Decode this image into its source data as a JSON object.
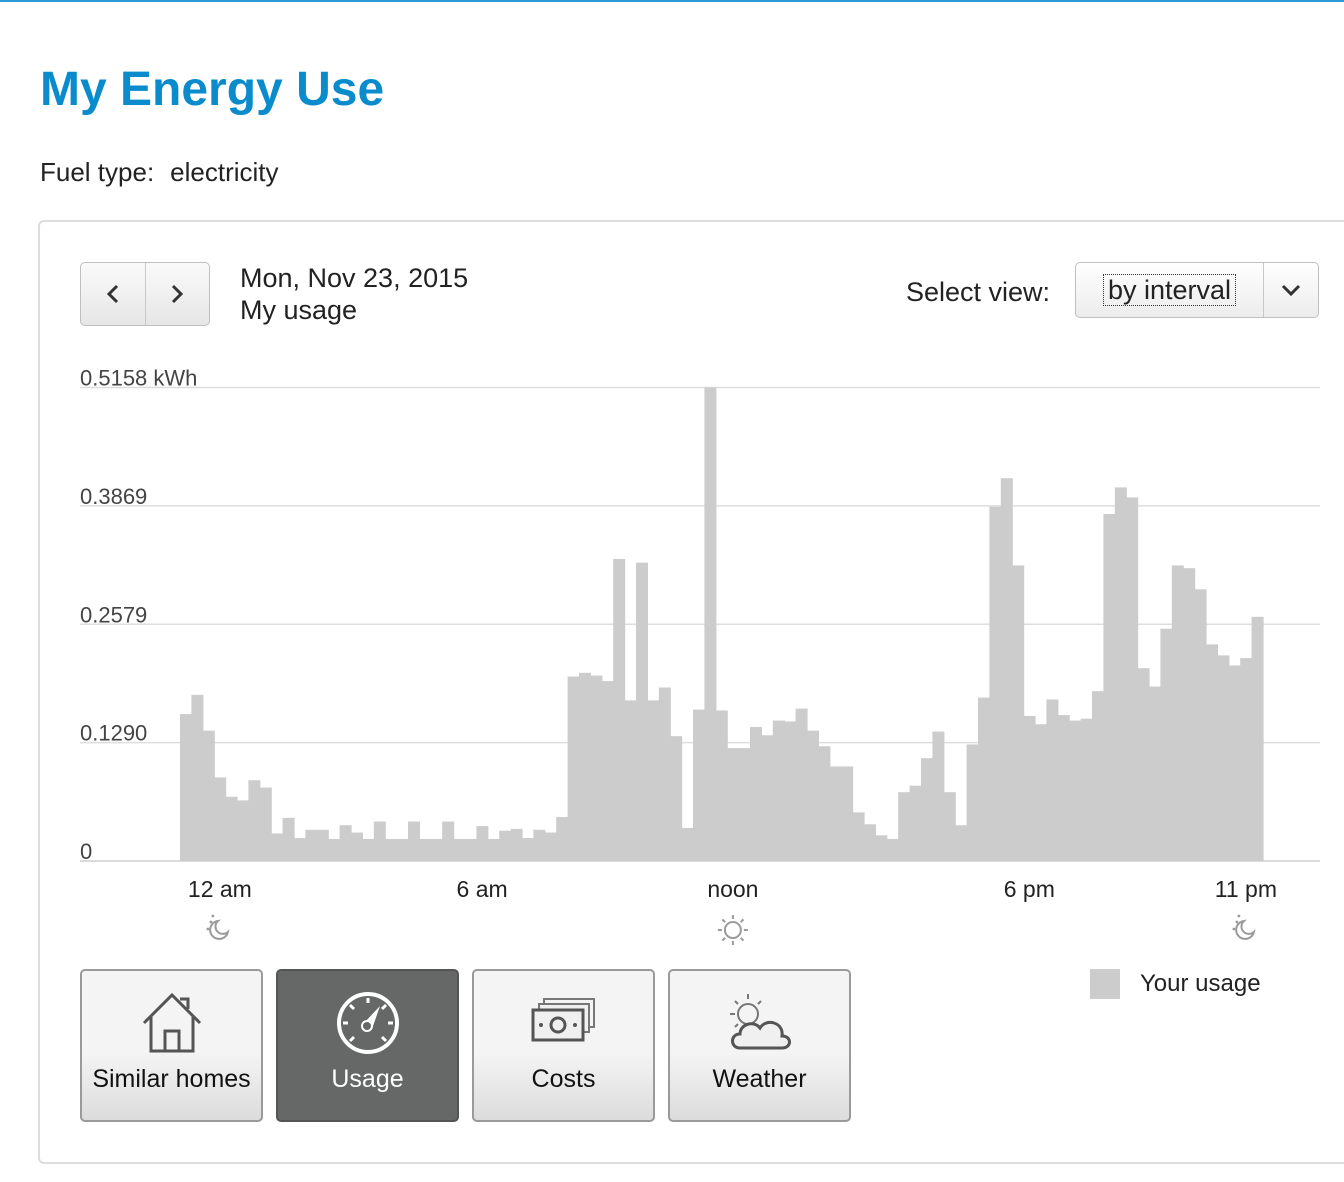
{
  "header": {
    "title": "My Energy Use",
    "fuel_label": "Fuel type:",
    "fuel_value": "electricity"
  },
  "controls": {
    "date": "Mon, Nov 23, 2015",
    "subtitle": "My usage",
    "view_label": "Select view:",
    "view_value": "by interval",
    "prev_icon": "chevron-left-icon",
    "next_icon": "chevron-right-icon"
  },
  "chart_data": {
    "type": "bar",
    "ylabel": "",
    "y_ticks": [
      {
        "value": 0.5158,
        "label": "0.5158 kWh"
      },
      {
        "value": 0.3869,
        "label": "0.3869"
      },
      {
        "value": 0.2579,
        "label": "0.2579"
      },
      {
        "value": 0.129,
        "label": "0.1290"
      },
      {
        "value": 0,
        "label": "0"
      }
    ],
    "ylim": [
      0,
      0.5158
    ],
    "grid": true,
    "bar_color": "#cccccc",
    "x_ticks": [
      {
        "interval": 3,
        "label": "12 am",
        "icon": "moon"
      },
      {
        "interval": 26,
        "label": "6 am",
        "icon": ""
      },
      {
        "interval": 48,
        "label": "noon",
        "icon": "sun"
      },
      {
        "interval": 74,
        "label": "6 pm",
        "icon": ""
      },
      {
        "interval": 93,
        "label": "11 pm",
        "icon": "moon"
      }
    ],
    "values": [
      0.16,
      0.181,
      0.142,
      0.091,
      0.07,
      0.066,
      0.088,
      0.08,
      0.03,
      0.047,
      0.025,
      0.034,
      0.034,
      0.024,
      0.039,
      0.031,
      0.024,
      0.043,
      0.024,
      0.024,
      0.043,
      0.024,
      0.024,
      0.043,
      0.024,
      0.024,
      0.038,
      0.024,
      0.033,
      0.035,
      0.025,
      0.034,
      0.031,
      0.048,
      0.201,
      0.205,
      0.202,
      0.196,
      0.329,
      0.175,
      0.325,
      0.175,
      0.189,
      0.136,
      0.036,
      0.165,
      0.5158,
      0.164,
      0.123,
      0.123,
      0.146,
      0.137,
      0.153,
      0.152,
      0.166,
      0.142,
      0.125,
      0.103,
      0.103,
      0.053,
      0.04,
      0.028,
      0.024,
      0.075,
      0.082,
      0.112,
      0.141,
      0.075,
      0.039,
      0.127,
      0.178,
      0.386,
      0.417,
      0.322,
      0.158,
      0.149,
      0.176,
      0.159,
      0.153,
      0.155,
      0.185,
      0.378,
      0.407,
      0.396,
      0.21,
      0.19,
      0.253,
      0.322,
      0.319,
      0.296,
      0.236,
      0.224,
      0.213,
      0.221,
      0.266
    ]
  },
  "tiles": [
    {
      "label": "Similar homes",
      "icon": "house-icon"
    },
    {
      "label": "Usage",
      "icon": "gauge-icon"
    },
    {
      "label": "Costs",
      "icon": "money-icon"
    },
    {
      "label": "Weather",
      "icon": "weather-icon"
    }
  ],
  "legend": {
    "label": "Your usage",
    "color": "#cccccc"
  },
  "colors": {
    "brand": "#0a8ccc",
    "active_tile": "#666767"
  }
}
